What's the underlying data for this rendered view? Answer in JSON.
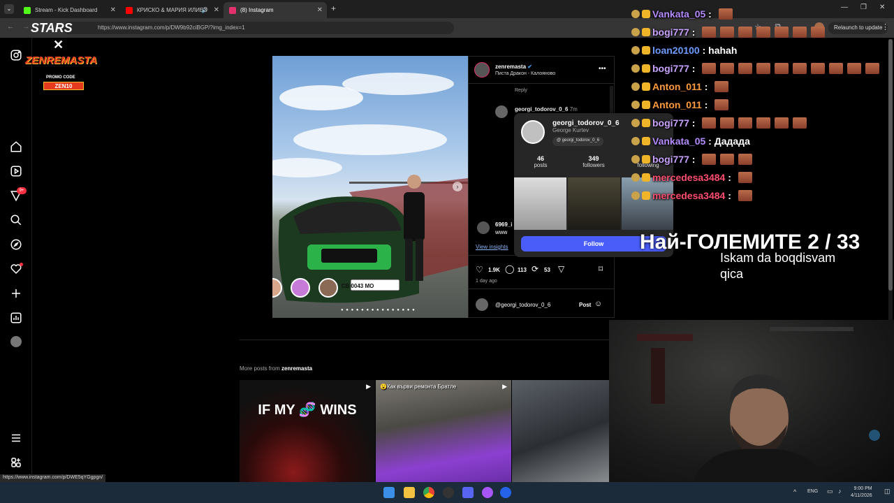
{
  "browser": {
    "tabs": [
      {
        "label": "Stream - Kick Dashboard",
        "color": "#53fc18"
      },
      {
        "label": "КРИСКО & МАРИЯ ИЛИЕВ",
        "color": "#ff0000"
      },
      {
        "label": "(8) Instagram",
        "color": "#e1306c"
      }
    ],
    "url": "https://www.instagram.com/p/DW9b92ciBGP/?img_index=1",
    "relaunch_label": "Relaunch to update",
    "status_url": "https://www.instagram.com/p/DWE5qYGgpgn/"
  },
  "overlay": {
    "promo_line1": "STARS",
    "brand": "ZENREMASTA",
    "promo_line2": "PROMO CODE",
    "promo_code": "ZEN10",
    "goal_title": "Най-ГОЛЕМИТЕ 2 / 33",
    "goal_sub_line1": "Iskam da boqdisvam",
    "goal_sub_line2": "qica"
  },
  "ig": {
    "notif_badge": "9+",
    "post": {
      "username": "zenremasta",
      "location": "Писта Дракон - Калояново",
      "reply_label": "Reply",
      "commenter": "georgi_todorov_0_6",
      "comment_time": "7m",
      "partial_user": "6969_i",
      "partial_text": "www",
      "view_insights": "View insights",
      "likes": "1.9K",
      "comments": "113",
      "reposts": "53",
      "posted_ago": "1 day ago",
      "comment_input": "@georgi_todorov_0_6",
      "post_button": "Post",
      "plate": "CB 0043 MO"
    },
    "hovercard": {
      "username": "georgi_todorov_0_6",
      "full_name": "George Kurtev",
      "threads_handle": "georgi_todorov_0_6",
      "posts_count": "46",
      "posts_label": "posts",
      "followers_count": "349",
      "followers_label": "followers",
      "following_label": "following",
      "follow_label": "Follow"
    },
    "more_posts": {
      "prefix": "More posts from",
      "user": "zenremasta",
      "thumb1_text": "IF MY 🧬 WINS",
      "thumb2_text": "😮Как върви ремонта Братле"
    }
  },
  "chat": [
    {
      "user": "Vankata_05",
      "color": "#b48cff",
      "msg": "",
      "emotes": 1
    },
    {
      "user": "bogi777",
      "color": "#c8a2ff",
      "msg": "",
      "emotes": 7
    },
    {
      "user": "loan20100",
      "color": "#6d9bff",
      "msg": "hahah",
      "emotes": 0
    },
    {
      "user": "bogi777",
      "color": "#c8a2ff",
      "msg": "",
      "emotes": 10
    },
    {
      "user": "Anton_011",
      "color": "#ff9a3c",
      "msg": "",
      "emotes": 1
    },
    {
      "user": "Anton_011",
      "color": "#ff9a3c",
      "msg": "",
      "emotes": 1
    },
    {
      "user": "bogi777",
      "color": "#c8a2ff",
      "msg": "",
      "emotes": 6
    },
    {
      "user": "Vankata_05",
      "color": "#b48cff",
      "msg": "Дадада",
      "emotes": 0
    },
    {
      "user": "bogi777",
      "color": "#c8a2ff",
      "msg": "",
      "emotes": 3
    },
    {
      "user": "mercedesa3484",
      "color": "#ff4d6d",
      "msg": "",
      "emotes": 1
    },
    {
      "user": "mercedesa3484",
      "color": "#ff4d6d",
      "msg": "",
      "emotes": 1
    }
  ],
  "taskbar": {
    "lang": "ENG",
    "time": "9:00 PM",
    "date": "4/11/2026"
  }
}
